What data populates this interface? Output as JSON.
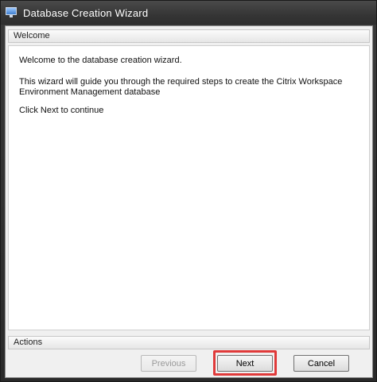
{
  "window": {
    "title": "Database Creation Wizard"
  },
  "welcome": {
    "header": "Welcome",
    "line1": "Welcome to the database creation wizard.",
    "line2": "This wizard will guide you through the required steps to create the Citrix Workspace Environment Management database",
    "line3": "Click Next to continue"
  },
  "actions": {
    "header": "Actions",
    "previous_label": "Previous",
    "next_label": "Next",
    "cancel_label": "Cancel"
  },
  "colors": {
    "highlight": "#e03a3a",
    "titlebar": "#353535"
  },
  "icons": {
    "app": "monitor-icon"
  }
}
